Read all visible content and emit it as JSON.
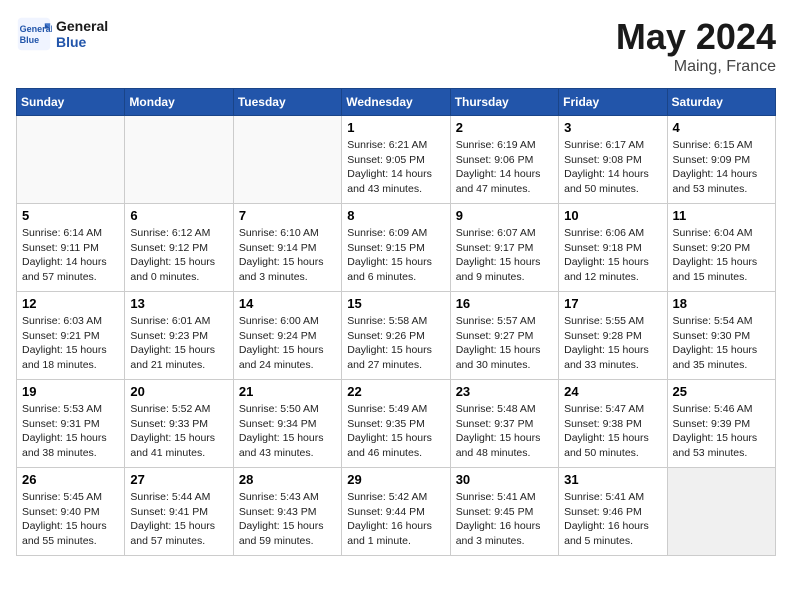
{
  "header": {
    "logo_line1": "General",
    "logo_line2": "Blue",
    "month": "May 2024",
    "location": "Maing, France"
  },
  "weekdays": [
    "Sunday",
    "Monday",
    "Tuesday",
    "Wednesday",
    "Thursday",
    "Friday",
    "Saturday"
  ],
  "weeks": [
    [
      {
        "day": "",
        "info": ""
      },
      {
        "day": "",
        "info": ""
      },
      {
        "day": "",
        "info": ""
      },
      {
        "day": "1",
        "info": "Sunrise: 6:21 AM\nSunset: 9:05 PM\nDaylight: 14 hours\nand 43 minutes."
      },
      {
        "day": "2",
        "info": "Sunrise: 6:19 AM\nSunset: 9:06 PM\nDaylight: 14 hours\nand 47 minutes."
      },
      {
        "day": "3",
        "info": "Sunrise: 6:17 AM\nSunset: 9:08 PM\nDaylight: 14 hours\nand 50 minutes."
      },
      {
        "day": "4",
        "info": "Sunrise: 6:15 AM\nSunset: 9:09 PM\nDaylight: 14 hours\nand 53 minutes."
      }
    ],
    [
      {
        "day": "5",
        "info": "Sunrise: 6:14 AM\nSunset: 9:11 PM\nDaylight: 14 hours\nand 57 minutes."
      },
      {
        "day": "6",
        "info": "Sunrise: 6:12 AM\nSunset: 9:12 PM\nDaylight: 15 hours\nand 0 minutes."
      },
      {
        "day": "7",
        "info": "Sunrise: 6:10 AM\nSunset: 9:14 PM\nDaylight: 15 hours\nand 3 minutes."
      },
      {
        "day": "8",
        "info": "Sunrise: 6:09 AM\nSunset: 9:15 PM\nDaylight: 15 hours\nand 6 minutes."
      },
      {
        "day": "9",
        "info": "Sunrise: 6:07 AM\nSunset: 9:17 PM\nDaylight: 15 hours\nand 9 minutes."
      },
      {
        "day": "10",
        "info": "Sunrise: 6:06 AM\nSunset: 9:18 PM\nDaylight: 15 hours\nand 12 minutes."
      },
      {
        "day": "11",
        "info": "Sunrise: 6:04 AM\nSunset: 9:20 PM\nDaylight: 15 hours\nand 15 minutes."
      }
    ],
    [
      {
        "day": "12",
        "info": "Sunrise: 6:03 AM\nSunset: 9:21 PM\nDaylight: 15 hours\nand 18 minutes."
      },
      {
        "day": "13",
        "info": "Sunrise: 6:01 AM\nSunset: 9:23 PM\nDaylight: 15 hours\nand 21 minutes."
      },
      {
        "day": "14",
        "info": "Sunrise: 6:00 AM\nSunset: 9:24 PM\nDaylight: 15 hours\nand 24 minutes."
      },
      {
        "day": "15",
        "info": "Sunrise: 5:58 AM\nSunset: 9:26 PM\nDaylight: 15 hours\nand 27 minutes."
      },
      {
        "day": "16",
        "info": "Sunrise: 5:57 AM\nSunset: 9:27 PM\nDaylight: 15 hours\nand 30 minutes."
      },
      {
        "day": "17",
        "info": "Sunrise: 5:55 AM\nSunset: 9:28 PM\nDaylight: 15 hours\nand 33 minutes."
      },
      {
        "day": "18",
        "info": "Sunrise: 5:54 AM\nSunset: 9:30 PM\nDaylight: 15 hours\nand 35 minutes."
      }
    ],
    [
      {
        "day": "19",
        "info": "Sunrise: 5:53 AM\nSunset: 9:31 PM\nDaylight: 15 hours\nand 38 minutes."
      },
      {
        "day": "20",
        "info": "Sunrise: 5:52 AM\nSunset: 9:33 PM\nDaylight: 15 hours\nand 41 minutes."
      },
      {
        "day": "21",
        "info": "Sunrise: 5:50 AM\nSunset: 9:34 PM\nDaylight: 15 hours\nand 43 minutes."
      },
      {
        "day": "22",
        "info": "Sunrise: 5:49 AM\nSunset: 9:35 PM\nDaylight: 15 hours\nand 46 minutes."
      },
      {
        "day": "23",
        "info": "Sunrise: 5:48 AM\nSunset: 9:37 PM\nDaylight: 15 hours\nand 48 minutes."
      },
      {
        "day": "24",
        "info": "Sunrise: 5:47 AM\nSunset: 9:38 PM\nDaylight: 15 hours\nand 50 minutes."
      },
      {
        "day": "25",
        "info": "Sunrise: 5:46 AM\nSunset: 9:39 PM\nDaylight: 15 hours\nand 53 minutes."
      }
    ],
    [
      {
        "day": "26",
        "info": "Sunrise: 5:45 AM\nSunset: 9:40 PM\nDaylight: 15 hours\nand 55 minutes."
      },
      {
        "day": "27",
        "info": "Sunrise: 5:44 AM\nSunset: 9:41 PM\nDaylight: 15 hours\nand 57 minutes."
      },
      {
        "day": "28",
        "info": "Sunrise: 5:43 AM\nSunset: 9:43 PM\nDaylight: 15 hours\nand 59 minutes."
      },
      {
        "day": "29",
        "info": "Sunrise: 5:42 AM\nSunset: 9:44 PM\nDaylight: 16 hours\nand 1 minute."
      },
      {
        "day": "30",
        "info": "Sunrise: 5:41 AM\nSunset: 9:45 PM\nDaylight: 16 hours\nand 3 minutes."
      },
      {
        "day": "31",
        "info": "Sunrise: 5:41 AM\nSunset: 9:46 PM\nDaylight: 16 hours\nand 5 minutes."
      },
      {
        "day": "",
        "info": ""
      }
    ]
  ]
}
